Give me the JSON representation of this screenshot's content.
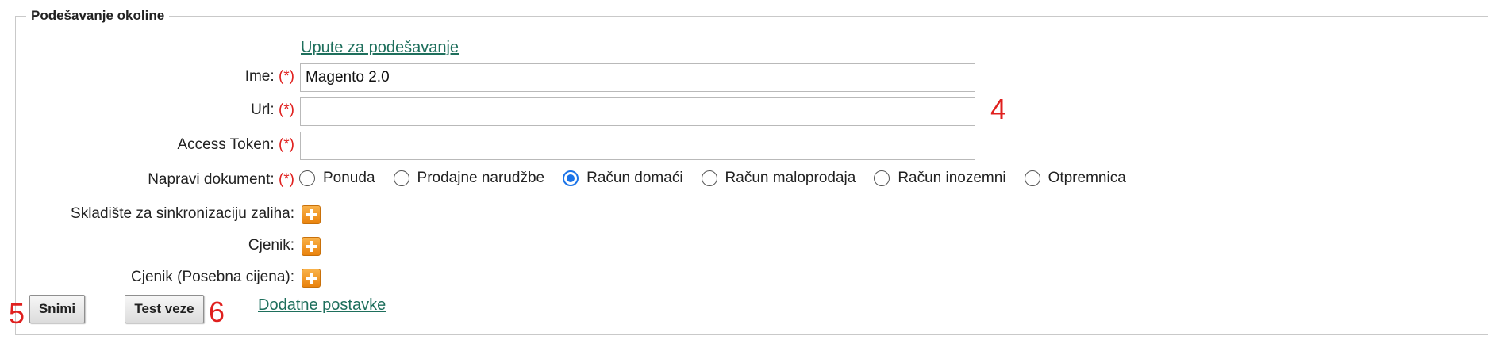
{
  "section": {
    "legend": "Podešavanje okoline",
    "help_link": "Upute za podešavanje"
  },
  "required_marker": "(*)",
  "fields": {
    "name": {
      "label": "Ime:",
      "value": "Magento 2.0",
      "placeholder": ""
    },
    "url": {
      "label": "Url:",
      "value": "",
      "placeholder": ""
    },
    "access_token": {
      "label": "Access Token:",
      "value": "",
      "placeholder": ""
    }
  },
  "document": {
    "label": "Napravi dokument:",
    "options": [
      "Ponuda",
      "Prodajne narudžbe",
      "Račun domaći",
      "Račun maloprodaja",
      "Račun inozemni",
      "Otpremnica"
    ],
    "selected": "Račun domaći"
  },
  "sync": {
    "warehouse_label": "Skladište za sinkronizaciju zaliha:",
    "pricelist_label": "Cjenik:",
    "special_pricelist_label": "Cjenik (Posebna cijena):"
  },
  "actions": {
    "save_label": "Snimi",
    "test_label": "Test veze",
    "more_settings_link": "Dodatne postavke"
  },
  "annotations": {
    "url_marker": "4",
    "save_marker": "5",
    "test_marker": "6"
  },
  "colors": {
    "required": "#e0201e",
    "link": "#1e6f5c",
    "radio_selected": "#1a73e8",
    "annotation": "#e0201e"
  },
  "icons": {
    "add": "plus-icon"
  }
}
